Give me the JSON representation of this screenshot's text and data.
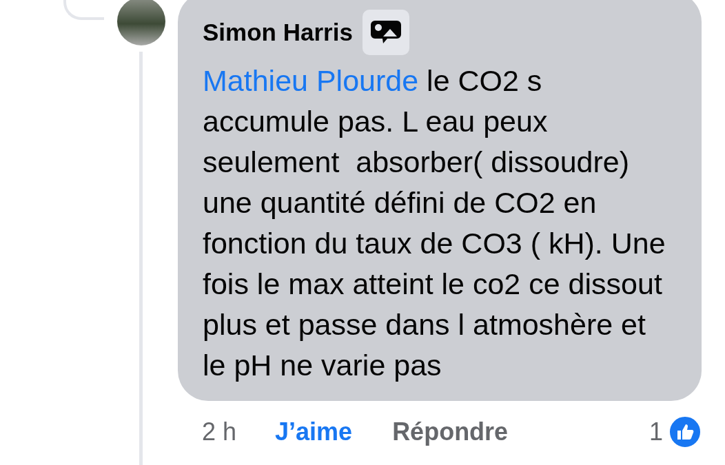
{
  "comment": {
    "author": "Simon Harris",
    "mention": "Mathieu Plourde",
    "text": "le CO2 s accumule pas. L eau peux seulement  absorber( dissoudre) une quantité défini de CO2 en fonction du taux de CO3 ( kH). Une fois le max atteint le co2 ce dissout plus et passe dans l atmoshère et le pH ne varie pas"
  },
  "footer": {
    "time": "2 h",
    "like": {
      "label": "J’aime",
      "selected": true
    },
    "reply": "Répondre",
    "reaction_count": "1"
  }
}
